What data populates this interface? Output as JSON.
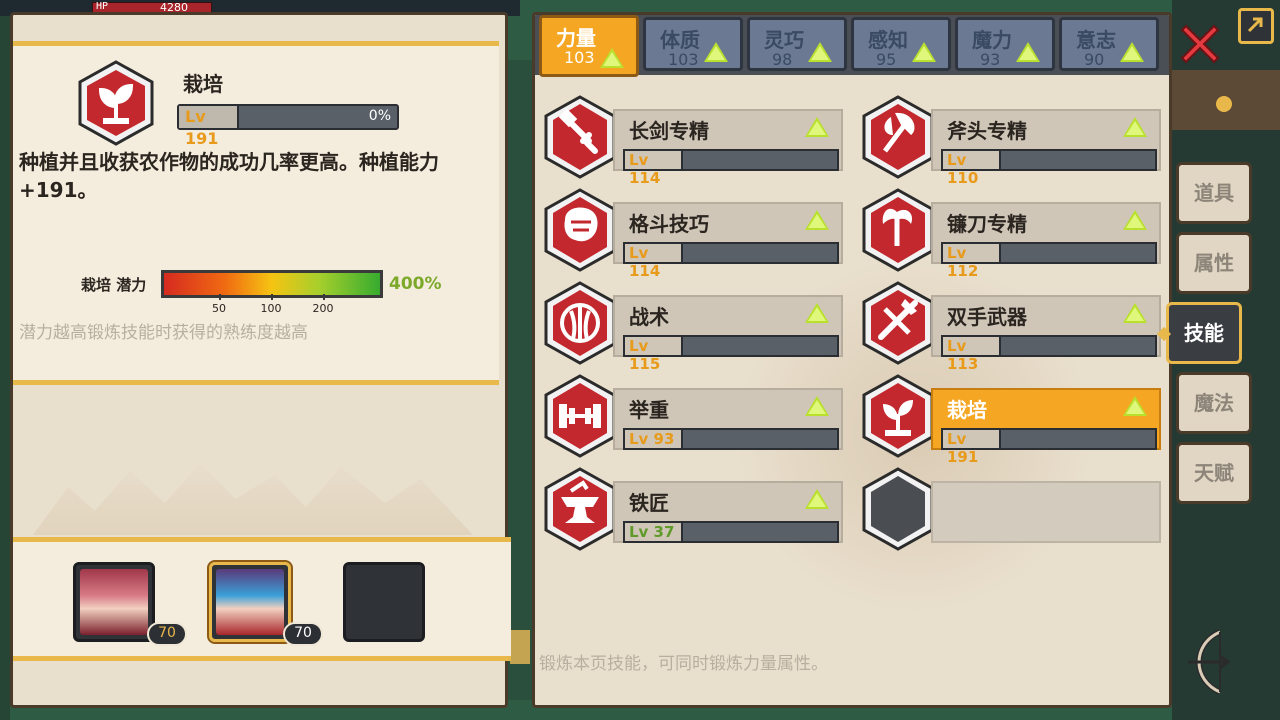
{
  "colors": {
    "accent": "#f5a623",
    "hex_red": "#c2282d",
    "tab_blue": "#6b7a92",
    "panel": "#e9dfcd",
    "lv_orange": "#e89a1a",
    "lv_green": "#5f9a2a"
  },
  "hud": {
    "hp_label": "HP",
    "hp_value": "4280"
  },
  "detail": {
    "icon": "sprout-icon",
    "name": "栽培",
    "level": "Lv 191",
    "progress_pct": "0%",
    "progress": 0,
    "description": "种植并且收获农作物的成功几率更高。种植能力+191。",
    "potential_label": "栽培 潜力",
    "potential_ticks": [
      "50",
      "100",
      "200"
    ],
    "potential_value": "400%",
    "potential_hint": "潜力越高锻炼技能时获得的熟练度越高"
  },
  "party": [
    {
      "name": "character-1",
      "level": "70"
    },
    {
      "name": "character-2",
      "level": "70",
      "selected": true
    },
    {
      "name": "empty-slot"
    }
  ],
  "stat_tabs": [
    {
      "name": "力量",
      "value": "103",
      "active": true
    },
    {
      "name": "体质",
      "value": "103"
    },
    {
      "name": "灵巧",
      "value": "98"
    },
    {
      "name": "感知",
      "value": "95"
    },
    {
      "name": "魔力",
      "value": "93"
    },
    {
      "name": "意志",
      "value": "90"
    }
  ],
  "skills": [
    {
      "name": "长剑专精",
      "level": "Lv 114",
      "icon": "sword-icon"
    },
    {
      "name": "斧头专精",
      "level": "Lv 110",
      "icon": "axe-icon"
    },
    {
      "name": "格斗技巧",
      "level": "Lv 114",
      "icon": "fist-icon"
    },
    {
      "name": "镰刀专精",
      "level": "Lv 112",
      "icon": "scythe-icon"
    },
    {
      "name": "战术",
      "level": "Lv 115",
      "icon": "tactics-icon"
    },
    {
      "name": "双手武器",
      "level": "Lv 113",
      "icon": "two-handed-icon"
    },
    {
      "name": "举重",
      "level": "Lv 93",
      "icon": "barbell-icon"
    },
    {
      "name": "栽培",
      "level": "Lv 191",
      "icon": "sprout-icon",
      "selected": true
    },
    {
      "name": "铁匠",
      "level": "Lv 37",
      "icon": "anvil-icon",
      "green": true
    },
    {
      "name": "",
      "level": "",
      "icon": "empty-hex-icon",
      "empty": true
    }
  ],
  "main_hint": "锻炼本页技能，可同时锻炼力量属性。",
  "side_tabs": [
    {
      "label": "道具"
    },
    {
      "label": "属性"
    },
    {
      "label": "技能",
      "active": true
    },
    {
      "label": "魔法"
    },
    {
      "label": "天赋"
    }
  ]
}
